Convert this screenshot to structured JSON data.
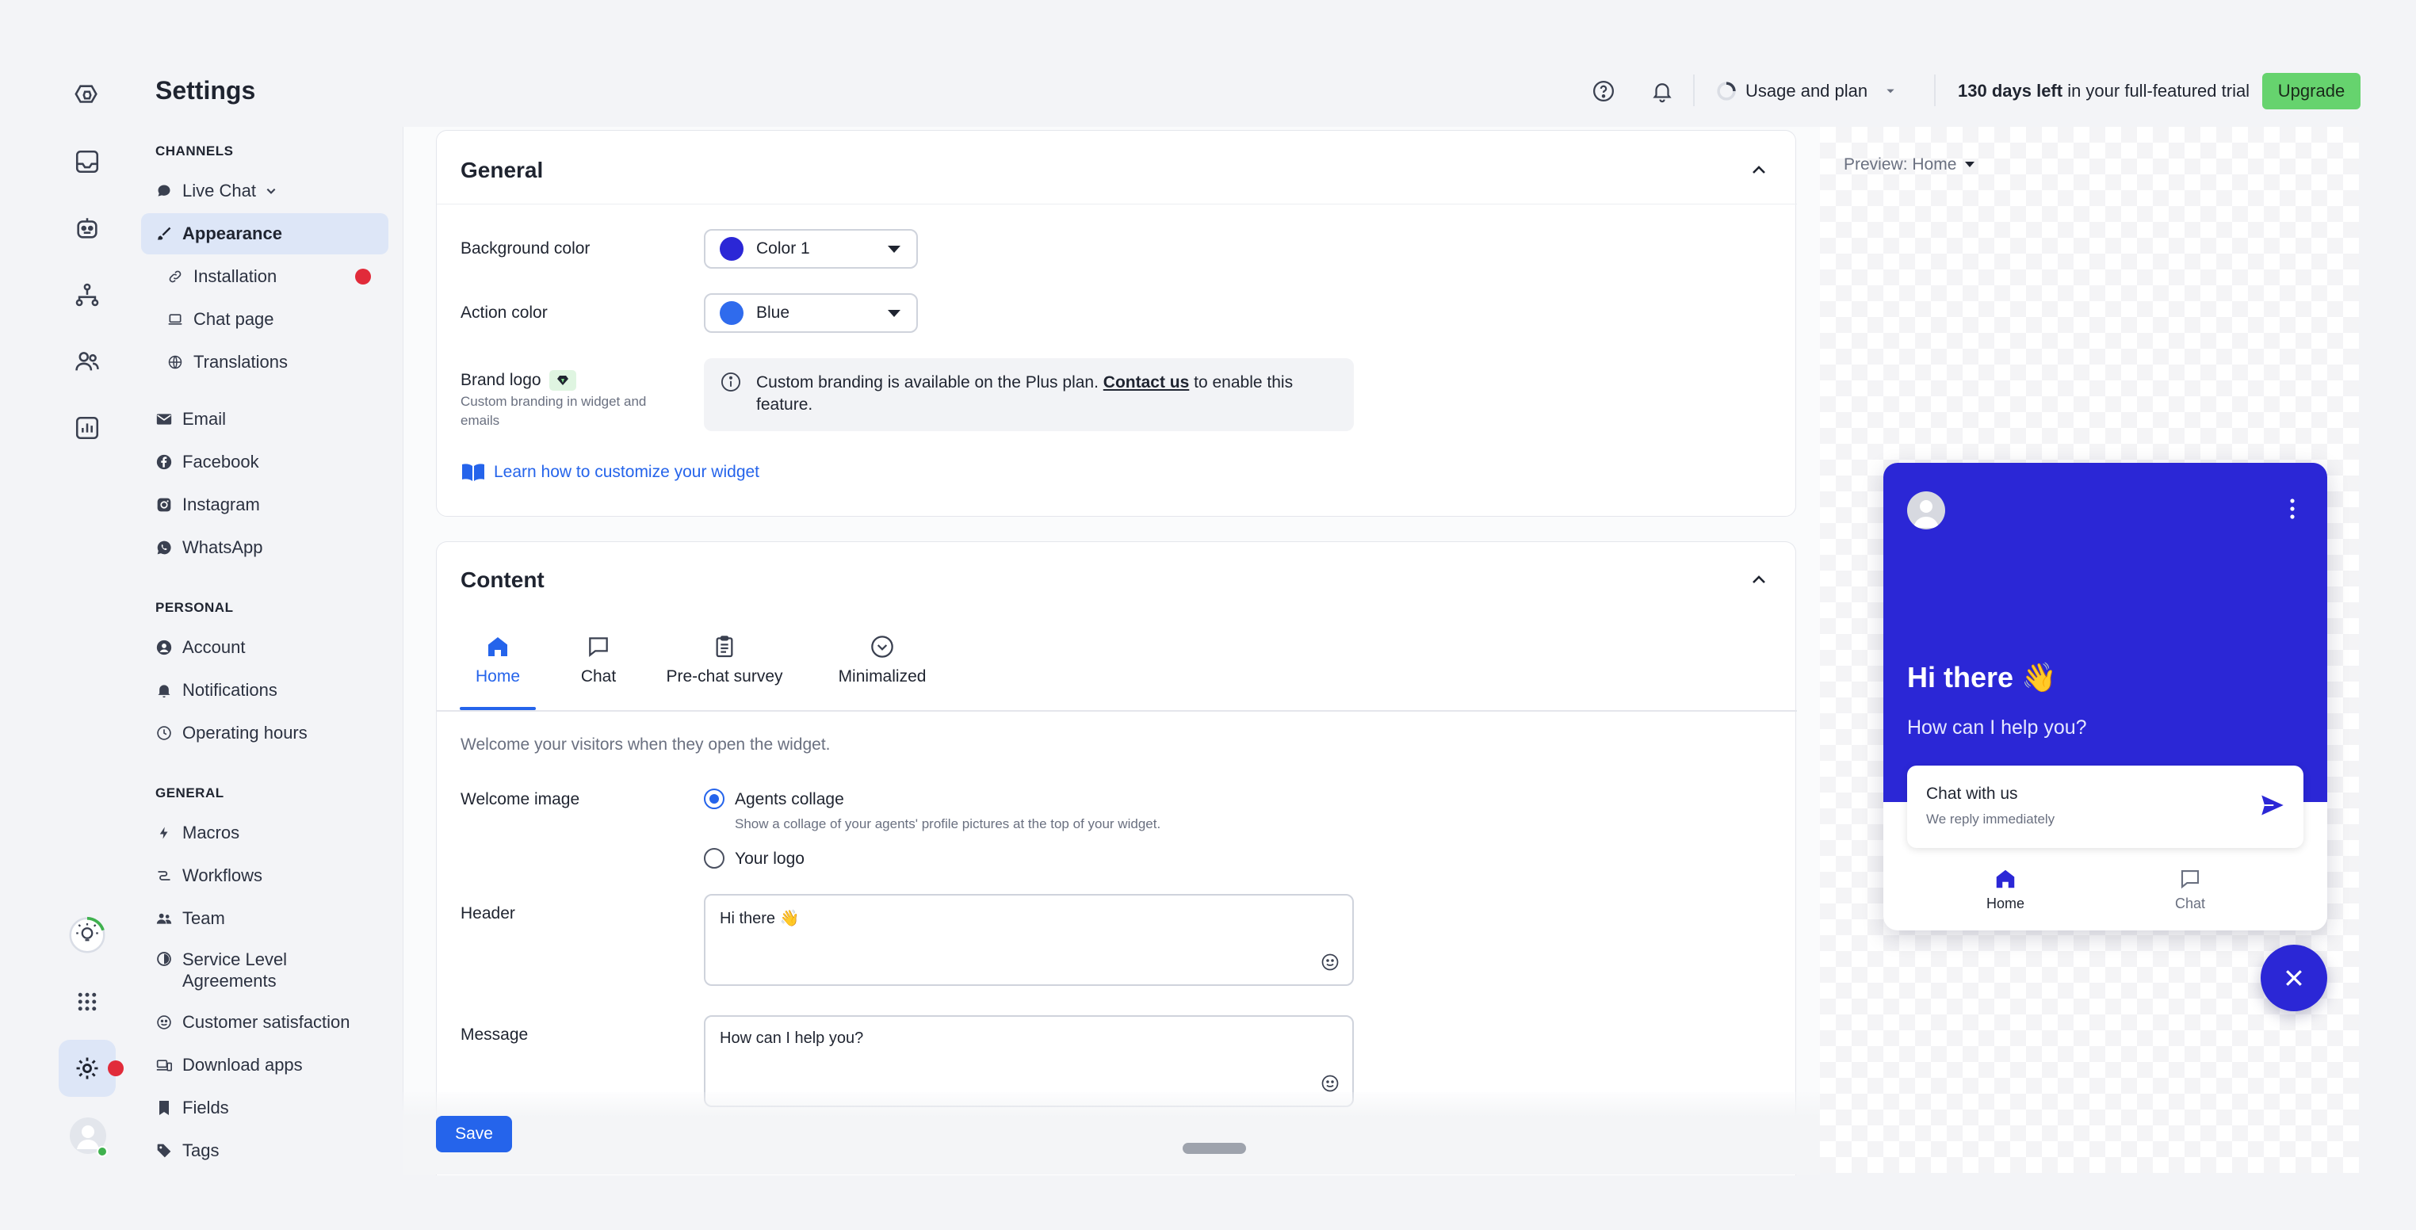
{
  "header": {
    "title": "Settings",
    "usage_label": "Usage and plan",
    "trial_bold": "130 days left",
    "trial_rest": " in your full-featured trial",
    "upgrade_label": "Upgrade"
  },
  "sidebar": {
    "channels_heading": "CHANNELS",
    "live_chat": "Live Chat",
    "appearance": "Appearance",
    "installation": "Installation",
    "chat_page": "Chat page",
    "translations": "Translations",
    "email": "Email",
    "facebook": "Facebook",
    "instagram": "Instagram",
    "whatsapp": "WhatsApp",
    "personal_heading": "PERSONAL",
    "account": "Account",
    "notifications": "Notifications",
    "operating_hours": "Operating hours",
    "general_heading": "GENERAL",
    "macros": "Macros",
    "workflows": "Workflows",
    "team": "Team",
    "sla_line1": "Service Level",
    "sla_line2": "Agreements",
    "customer_satisfaction": "Customer satisfaction",
    "download_apps": "Download apps",
    "fields": "Fields",
    "tags": "Tags"
  },
  "general": {
    "title": "General",
    "background_color_label": "Background color",
    "background_color_value": "Color 1",
    "background_swatch": "#2b27d6",
    "action_color_label": "Action color",
    "action_color_value": "Blue",
    "action_swatch": "#2f6bed",
    "brand_logo_label": "Brand logo",
    "brand_logo_sub1": "Custom branding in widget and",
    "brand_logo_sub2": "emails",
    "branding_notice_pre": "Custom branding is available on the Plus plan.",
    "branding_notice_link": "Contact us",
    "branding_notice_post": "to enable this",
    "branding_notice_line2": "feature.",
    "learn_link": "Learn how to customize your widget"
  },
  "content": {
    "title": "Content",
    "tabs": [
      "Home",
      "Chat",
      "Pre-chat survey",
      "Minimalized"
    ],
    "intro": "Welcome your visitors when they open the widget.",
    "welcome_image_label": "Welcome image",
    "option_agents": "Agents collage",
    "option_agents_desc": "Show a collage of your agents' profile pictures at the top of your widget.",
    "option_logo": "Your logo",
    "header_label": "Header",
    "header_value": "Hi there 👋",
    "message_label": "Message",
    "message_value": "How can I help you?"
  },
  "footer": {
    "save_label": "Save"
  },
  "preview": {
    "label": "Preview: Home",
    "greeting": "Hi there 👋",
    "subtitle": "How can I help you?",
    "card_title": "Chat with us",
    "card_sub": "We reply immediately",
    "nav_home": "Home",
    "nav_chat": "Chat"
  },
  "colors": {
    "accent": "#2564eb",
    "widget": "#2b27d6",
    "upgrade": "#66d36e",
    "alert": "#e12b3a"
  }
}
